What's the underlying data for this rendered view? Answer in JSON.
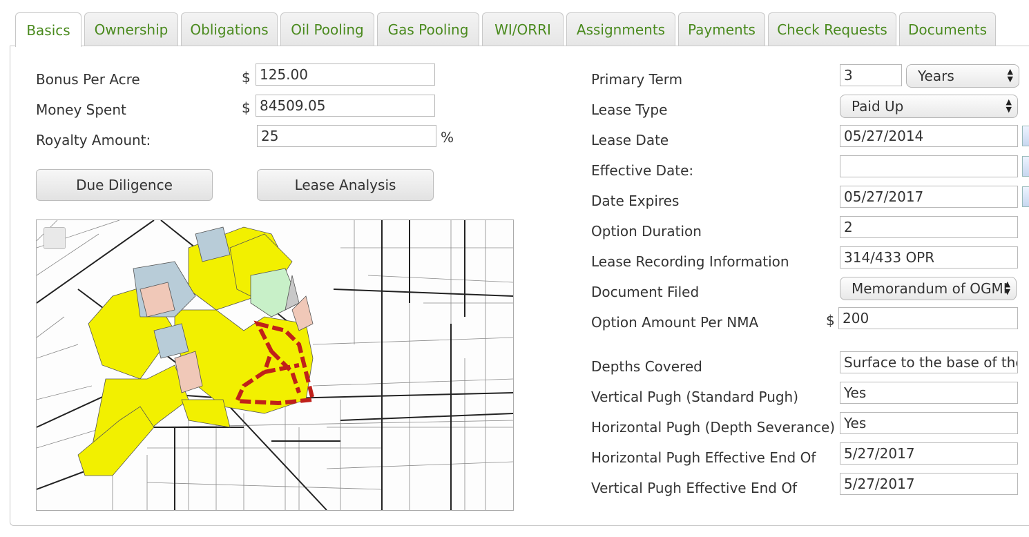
{
  "tabs": [
    "Basics",
    "Ownership",
    "Obligations",
    "Oil Pooling",
    "Gas Pooling",
    "WI/ORRI",
    "Assignments",
    "Payments",
    "Check Requests",
    "Documents"
  ],
  "active_tab": "Basics",
  "left": {
    "bonus_per_acre": {
      "label": "Bonus Per Acre",
      "currency": "$",
      "value": "125.00"
    },
    "money_spent": {
      "label": "Money Spent",
      "currency": "$",
      "value": "84509.05"
    },
    "royalty_amount": {
      "label": "Royalty Amount:",
      "value": "25",
      "unit": "%"
    },
    "buttons": {
      "due_diligence": "Due Diligence",
      "lease_analysis": "Lease Analysis"
    }
  },
  "right": {
    "primary_term": {
      "label": "Primary Term",
      "value": "3",
      "unit": "Years"
    },
    "lease_type": {
      "label": "Lease Type",
      "value": "Paid Up"
    },
    "lease_date": {
      "label": "Lease Date",
      "value": "05/27/2014"
    },
    "effective_date": {
      "label": "Effective Date:",
      "value": ""
    },
    "date_expires": {
      "label": "Date Expires",
      "value": "05/27/2017"
    },
    "option_duration": {
      "label": "Option Duration",
      "value": "2"
    },
    "lease_recording": {
      "label": "Lease Recording Information",
      "value": "314/433 OPR"
    },
    "document_filed": {
      "label": "Document Filed",
      "value": "Memorandum of OGMI"
    },
    "option_amount": {
      "label": "Option Amount Per NMA",
      "currency": "$",
      "value": "200"
    },
    "depths_covered": {
      "label": "Depths Covered",
      "value": "Surface to the base of the"
    },
    "vertical_pugh": {
      "label": "Vertical Pugh (Standard Pugh)",
      "value": "Yes"
    },
    "horizontal_pugh": {
      "label": "Horizontal Pugh (Depth Severance)",
      "value": "Yes"
    },
    "horizontal_pugh_end": {
      "label": "Horizontal Pugh Effective End Of",
      "value": "5/27/2017"
    },
    "vertical_pugh_end": {
      "label": "Vertical Pugh Effective End Of",
      "value": "5/27/2017"
    }
  },
  "colors": {
    "tab_text": "#4a8a1e",
    "lease_yellow": "#f2f000",
    "lease_red": "#c0201a",
    "parcel_blue": "#b8ccd8",
    "parcel_pink": "#f0c8b8",
    "parcel_green": "#c8f0c8"
  }
}
